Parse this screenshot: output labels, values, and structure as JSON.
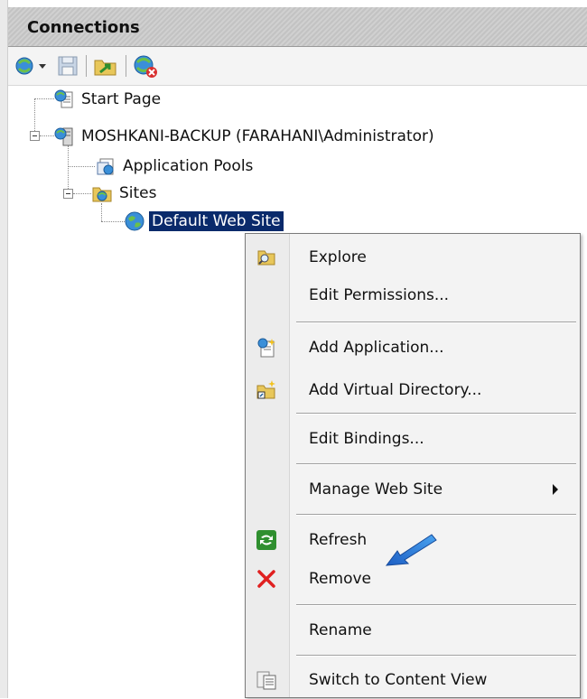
{
  "panel": {
    "title": "Connections"
  },
  "toolbar": {
    "buttons": [
      {
        "name": "connect-icon"
      },
      {
        "name": "save-icon"
      },
      {
        "name": "up-folder-icon"
      },
      {
        "name": "delete-connection-icon"
      }
    ]
  },
  "tree": {
    "start_page": "Start Page",
    "server": "MOSHKANI-BACKUP (FARAHANI\\Administrator)",
    "app_pools": "Application Pools",
    "sites": "Sites",
    "default_site": "Default Web Site"
  },
  "context_menu": {
    "explore": "Explore",
    "edit_permissions": "Edit Permissions...",
    "add_application": "Add Application...",
    "add_virtual_directory": "Add Virtual Directory...",
    "edit_bindings": "Edit Bindings...",
    "manage_web_site": "Manage Web Site",
    "refresh": "Refresh",
    "remove": "Remove",
    "rename": "Rename",
    "switch_to_content_view": "Switch to Content View"
  },
  "colors": {
    "selection": "#0a2a6b",
    "arrow": "#1e6fd9",
    "remove_icon": "#e02020",
    "refresh_icon": "#2f8f2f"
  }
}
